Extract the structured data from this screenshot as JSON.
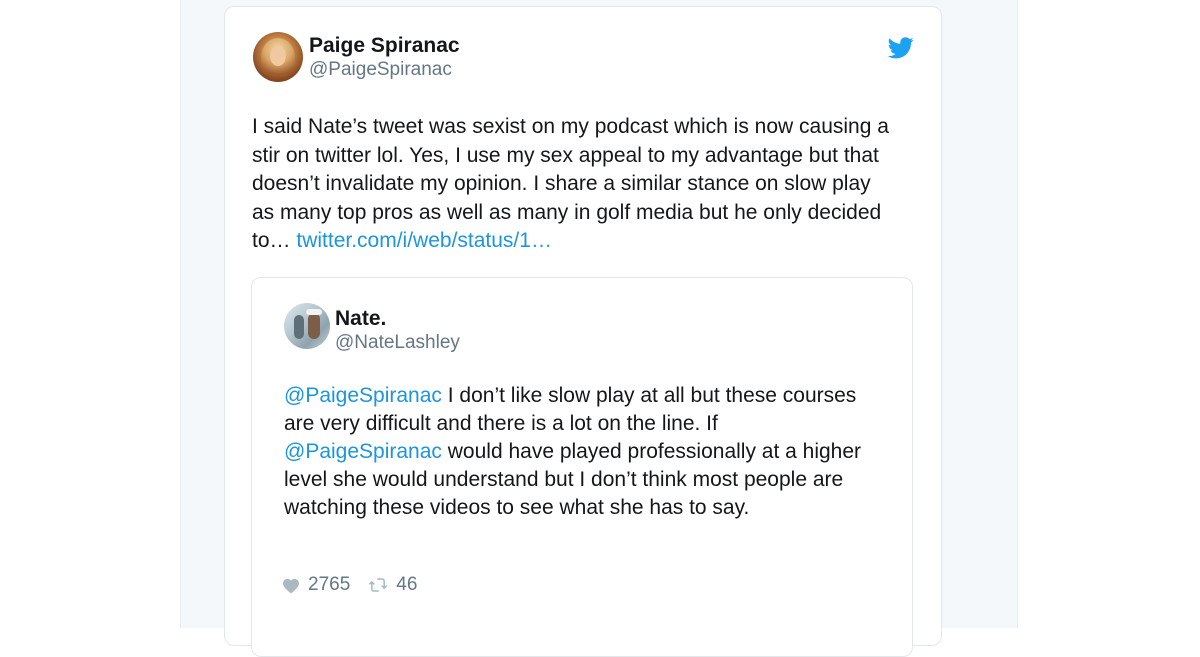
{
  "tweet": {
    "author_name": "Paige Spiranac",
    "author_handle": "@PaigeSpiranac",
    "text": "I said Nate’s tweet was sexist on my podcast which is now causing a\nstir on twitter lol. Yes, I use my sex appeal to my advantage but that\ndoesn’t invalidate my opinion. I share a similar stance on slow play\nas many top pros as well as many in golf media but he only decided\nto… ",
    "link_text": "twitter.com/i/web/status/1…"
  },
  "quoted_tweet": {
    "author_name": "Nate.",
    "author_handle": "@NateLashley",
    "mention_1": "@PaigeSpiranac",
    "text_1": " I don’t like slow play at all but these courses\nare very difficult and there is a lot on the line. If\n",
    "mention_2": "@PaigeSpiranac",
    "text_2": " would have played professionally at a higher\nlevel she would understand but I don’t think most people are\nwatching these videos to see what she has to say."
  },
  "stats": {
    "likes": "2765",
    "retweets": "46"
  },
  "icons": {
    "brand": "twitter-bird-icon",
    "like": "heart-icon",
    "retweet": "retweet-icon"
  },
  "colors": {
    "link": "#1b95e0",
    "brand": "#1da1f2",
    "muted": "#657786",
    "text": "#14171a"
  }
}
